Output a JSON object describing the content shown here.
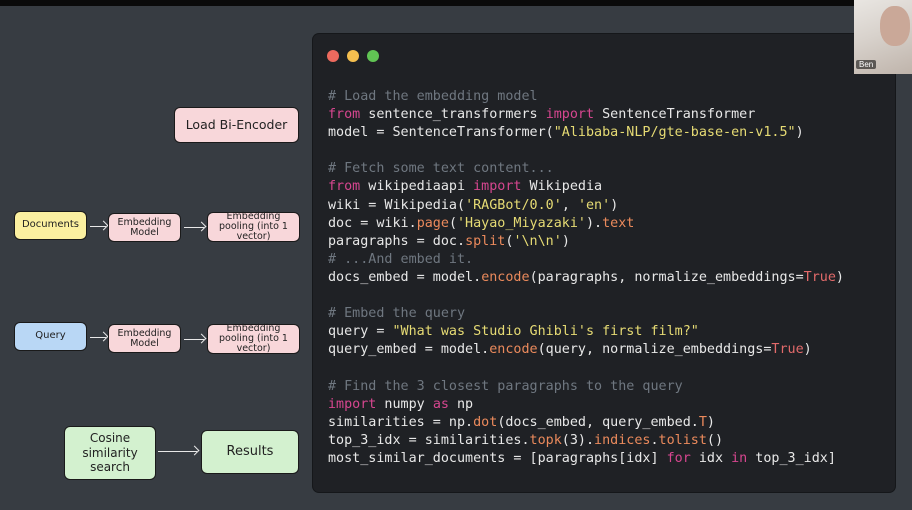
{
  "diagram": {
    "load_bi_encoder": "Load Bi-Encoder",
    "documents": "Documents",
    "embedding_model_1": "Embedding Model",
    "pooling_1": "Embedding pooling (into 1 vector)",
    "query": "Query",
    "embedding_model_2": "Embedding Model",
    "pooling_2": "Embedding pooling (into 1 vector)",
    "cosine_search": "Cosine similarity search",
    "results": "Results"
  },
  "code_lines": [
    [
      {
        "t": "# Load the embedding model",
        "c": "cm"
      }
    ],
    [
      {
        "t": "from",
        "c": "kw"
      },
      {
        "t": " sentence_transformers "
      },
      {
        "t": "import",
        "c": "kw"
      },
      {
        "t": " SentenceTransformer"
      }
    ],
    [
      {
        "t": "model = SentenceTransformer("
      },
      {
        "t": "\"Alibaba-NLP/gte-base-en-v1.5\"",
        "c": "st"
      },
      {
        "t": ")"
      }
    ],
    [
      {
        "t": ""
      }
    ],
    [
      {
        "t": "# Fetch some text content...",
        "c": "cm"
      }
    ],
    [
      {
        "t": "from",
        "c": "kw"
      },
      {
        "t": " wikipediaapi "
      },
      {
        "t": "import",
        "c": "kw"
      },
      {
        "t": " Wikipedia"
      }
    ],
    [
      {
        "t": "wiki = Wikipedia("
      },
      {
        "t": "'RAGBot/0.0'",
        "c": "st"
      },
      {
        "t": ", "
      },
      {
        "t": "'en'",
        "c": "st"
      },
      {
        "t": ")"
      }
    ],
    [
      {
        "t": "doc = wiki."
      },
      {
        "t": "page",
        "c": "fn"
      },
      {
        "t": "("
      },
      {
        "t": "'Hayao_Miyazaki'",
        "c": "st"
      },
      {
        "t": ")."
      },
      {
        "t": "text",
        "c": "fn"
      }
    ],
    [
      {
        "t": "paragraphs = doc."
      },
      {
        "t": "split",
        "c": "fn"
      },
      {
        "t": "("
      },
      {
        "t": "'\\n\\n'",
        "c": "st"
      },
      {
        "t": ")"
      }
    ],
    [
      {
        "t": "# ...And embed it.",
        "c": "cm"
      }
    ],
    [
      {
        "t": "docs_embed = model."
      },
      {
        "t": "encode",
        "c": "fn"
      },
      {
        "t": "(paragraphs, normalize_embeddings="
      },
      {
        "t": "True",
        "c": "bl"
      },
      {
        "t": ")"
      }
    ],
    [
      {
        "t": ""
      }
    ],
    [
      {
        "t": "# Embed the query",
        "c": "cm"
      }
    ],
    [
      {
        "t": "query = "
      },
      {
        "t": "\"What was Studio Ghibli's first film?\"",
        "c": "st"
      }
    ],
    [
      {
        "t": "query_embed = model."
      },
      {
        "t": "encode",
        "c": "fn"
      },
      {
        "t": "(query, normalize_embeddings="
      },
      {
        "t": "True",
        "c": "bl"
      },
      {
        "t": ")"
      }
    ],
    [
      {
        "t": ""
      }
    ],
    [
      {
        "t": "# Find the 3 closest paragraphs to the query",
        "c": "cm"
      }
    ],
    [
      {
        "t": "import",
        "c": "kw"
      },
      {
        "t": " numpy "
      },
      {
        "t": "as",
        "c": "kw"
      },
      {
        "t": " np"
      }
    ],
    [
      {
        "t": "similarities = np."
      },
      {
        "t": "dot",
        "c": "fn"
      },
      {
        "t": "(docs_embed, query_embed."
      },
      {
        "t": "T",
        "c": "fn"
      },
      {
        "t": ")"
      }
    ],
    [
      {
        "t": "top_3_idx = similarities."
      },
      {
        "t": "topk",
        "c": "fn"
      },
      {
        "t": "(3)."
      },
      {
        "t": "indices",
        "c": "fn"
      },
      {
        "t": "."
      },
      {
        "t": "tolist",
        "c": "fn"
      },
      {
        "t": "()"
      }
    ],
    [
      {
        "t": "most_similar_documents = [paragraphs[idx] "
      },
      {
        "t": "for",
        "c": "kw"
      },
      {
        "t": " idx "
      },
      {
        "t": "in",
        "c": "kw"
      },
      {
        "t": " top_3_idx]"
      }
    ]
  ],
  "webcam": {
    "name": "Ben"
  }
}
